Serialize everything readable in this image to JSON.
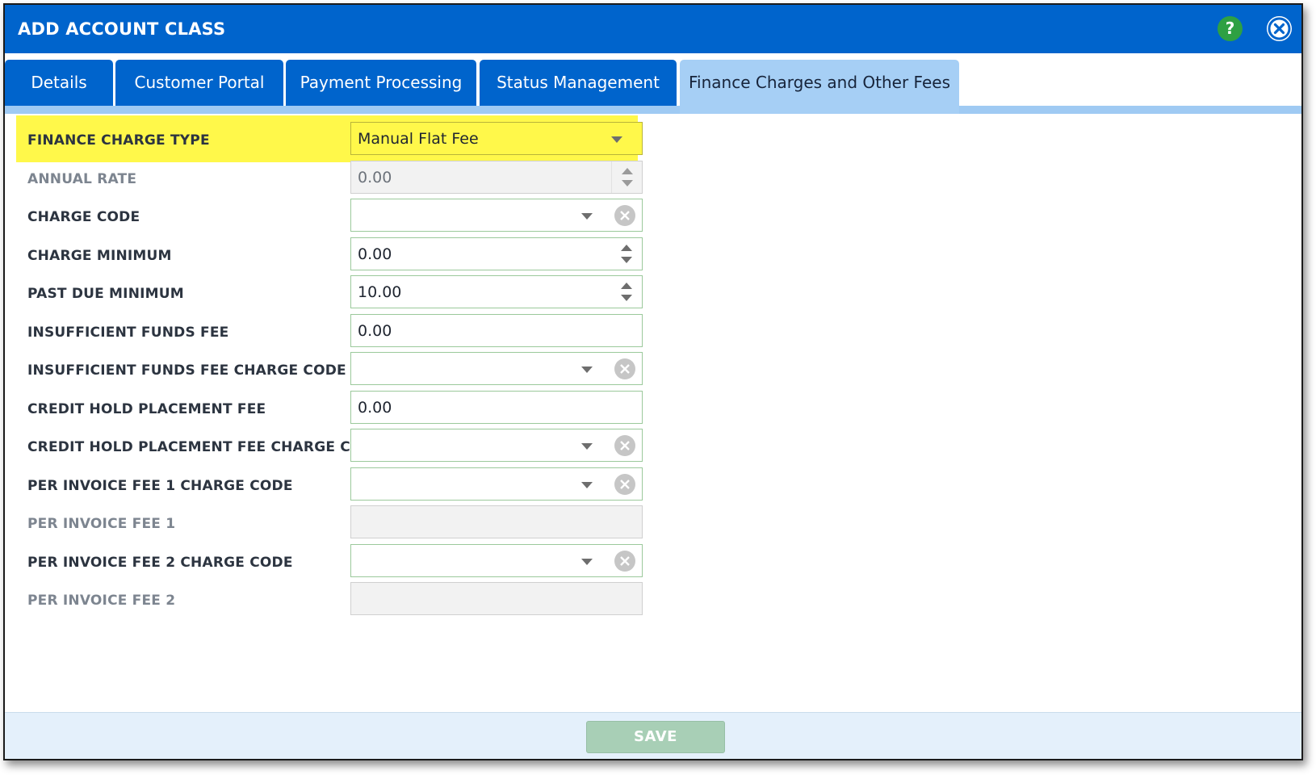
{
  "dialog": {
    "title": "ADD ACCOUNT CLASS",
    "help_label": "?",
    "header_color": "#0064cc"
  },
  "tabs": [
    {
      "label": "Details",
      "active": false
    },
    {
      "label": "Customer Portal",
      "active": false
    },
    {
      "label": "Payment Processing",
      "active": false
    },
    {
      "label": "Status Management",
      "active": false
    },
    {
      "label": "Finance Charges and Other Fees",
      "active": true
    }
  ],
  "form": {
    "finance_charge_type": {
      "label": "FINANCE CHARGE TYPE",
      "value": "Manual Flat Fee"
    },
    "annual_rate": {
      "label": "ANNUAL RATE",
      "value": "0.00"
    },
    "charge_code": {
      "label": "CHARGE CODE",
      "value": ""
    },
    "charge_minimum": {
      "label": "CHARGE MINIMUM",
      "value": "0.00"
    },
    "past_due_minimum": {
      "label": "PAST DUE MINIMUM",
      "value": "10.00"
    },
    "insufficient_funds_fee": {
      "label": "INSUFFICIENT FUNDS FEE",
      "value": "0.00"
    },
    "insufficient_funds_fee_charge_code": {
      "label": "INSUFFICIENT FUNDS FEE CHARGE CODE",
      "value": ""
    },
    "credit_hold_placement_fee": {
      "label": "CREDIT HOLD PLACEMENT FEE",
      "value": "0.00"
    },
    "credit_hold_placement_fee_charge_code": {
      "label": "CREDIT HOLD PLACEMENT FEE CHARGE CODE",
      "value": ""
    },
    "per_invoice_fee_1_charge_code": {
      "label": "PER INVOICE FEE 1 CHARGE CODE",
      "value": ""
    },
    "per_invoice_fee_1": {
      "label": "PER INVOICE FEE 1",
      "value": ""
    },
    "per_invoice_fee_2_charge_code": {
      "label": "PER INVOICE FEE 2 CHARGE CODE",
      "value": ""
    },
    "per_invoice_fee_2": {
      "label": "PER INVOICE FEE 2",
      "value": ""
    }
  },
  "footer": {
    "save_label": "SAVE"
  }
}
